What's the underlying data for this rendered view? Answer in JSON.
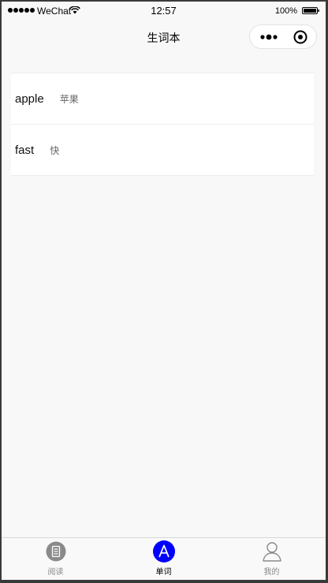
{
  "status_bar": {
    "carrier": "WeChat",
    "time": "12:57",
    "battery": "100%"
  },
  "nav": {
    "title": "生词本"
  },
  "words": [
    {
      "word": "apple",
      "meaning": "苹果"
    },
    {
      "word": "fast",
      "meaning": "快"
    }
  ],
  "tabs": [
    {
      "label": "阅读",
      "icon": "document-icon",
      "active": false
    },
    {
      "label": "单词",
      "icon": "letter-a-icon",
      "active": true
    },
    {
      "label": "我的",
      "icon": "person-icon",
      "active": false
    }
  ],
  "colors": {
    "active_tab": "#0000ff",
    "inactive_tab": "#8a8a8a"
  }
}
